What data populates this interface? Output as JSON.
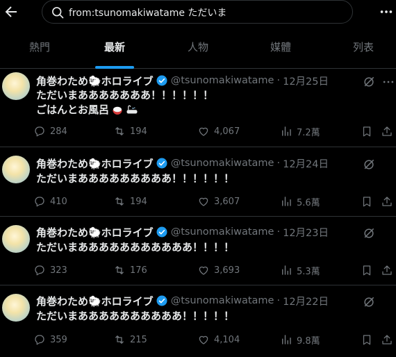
{
  "search": {
    "query": "from:tsunomakiwatame ただいま"
  },
  "tabs": [
    {
      "label": "熱門"
    },
    {
      "label": "最新"
    },
    {
      "label": "人物"
    },
    {
      "label": "媒體"
    },
    {
      "label": "列表"
    }
  ],
  "colors": {
    "accent": "#1d9bf0",
    "background": "#000000",
    "muted": "#71767b",
    "text": "#e7e9ea"
  },
  "tweets": [
    {
      "name": "角巻わため🐑ホロライブ",
      "handle": "@tsunomakiwatame",
      "date": "12月25日",
      "line1": "ただいまあああああああ！！！！！！",
      "line2": "ごはんとお風呂",
      "replies": "284",
      "retweets": "194",
      "likes": "4,067",
      "views": "7.2萬"
    },
    {
      "name": "角巻わため🐑ホロライブ",
      "handle": "@tsunomakiwatame",
      "date": "12月24日",
      "line1": "ただいまあああああああああ！！！！！！",
      "replies": "410",
      "retweets": "194",
      "likes": "3,607",
      "views": "5.6萬"
    },
    {
      "name": "角巻わため🐑ホロライブ",
      "handle": "@tsunomakiwatame",
      "date": "12月23日",
      "line1": "ただいまあああああああああああ！！！！",
      "replies": "323",
      "retweets": "176",
      "likes": "3,693",
      "views": "5.3萬"
    },
    {
      "name": "角巻わため🐑ホロライブ",
      "handle": "@tsunomakiwatame",
      "date": "12月22日",
      "line1": "ただいまああああああああああ！！！！！",
      "replies": "359",
      "retweets": "215",
      "likes": "4,104",
      "views": "9.8萬"
    }
  ]
}
